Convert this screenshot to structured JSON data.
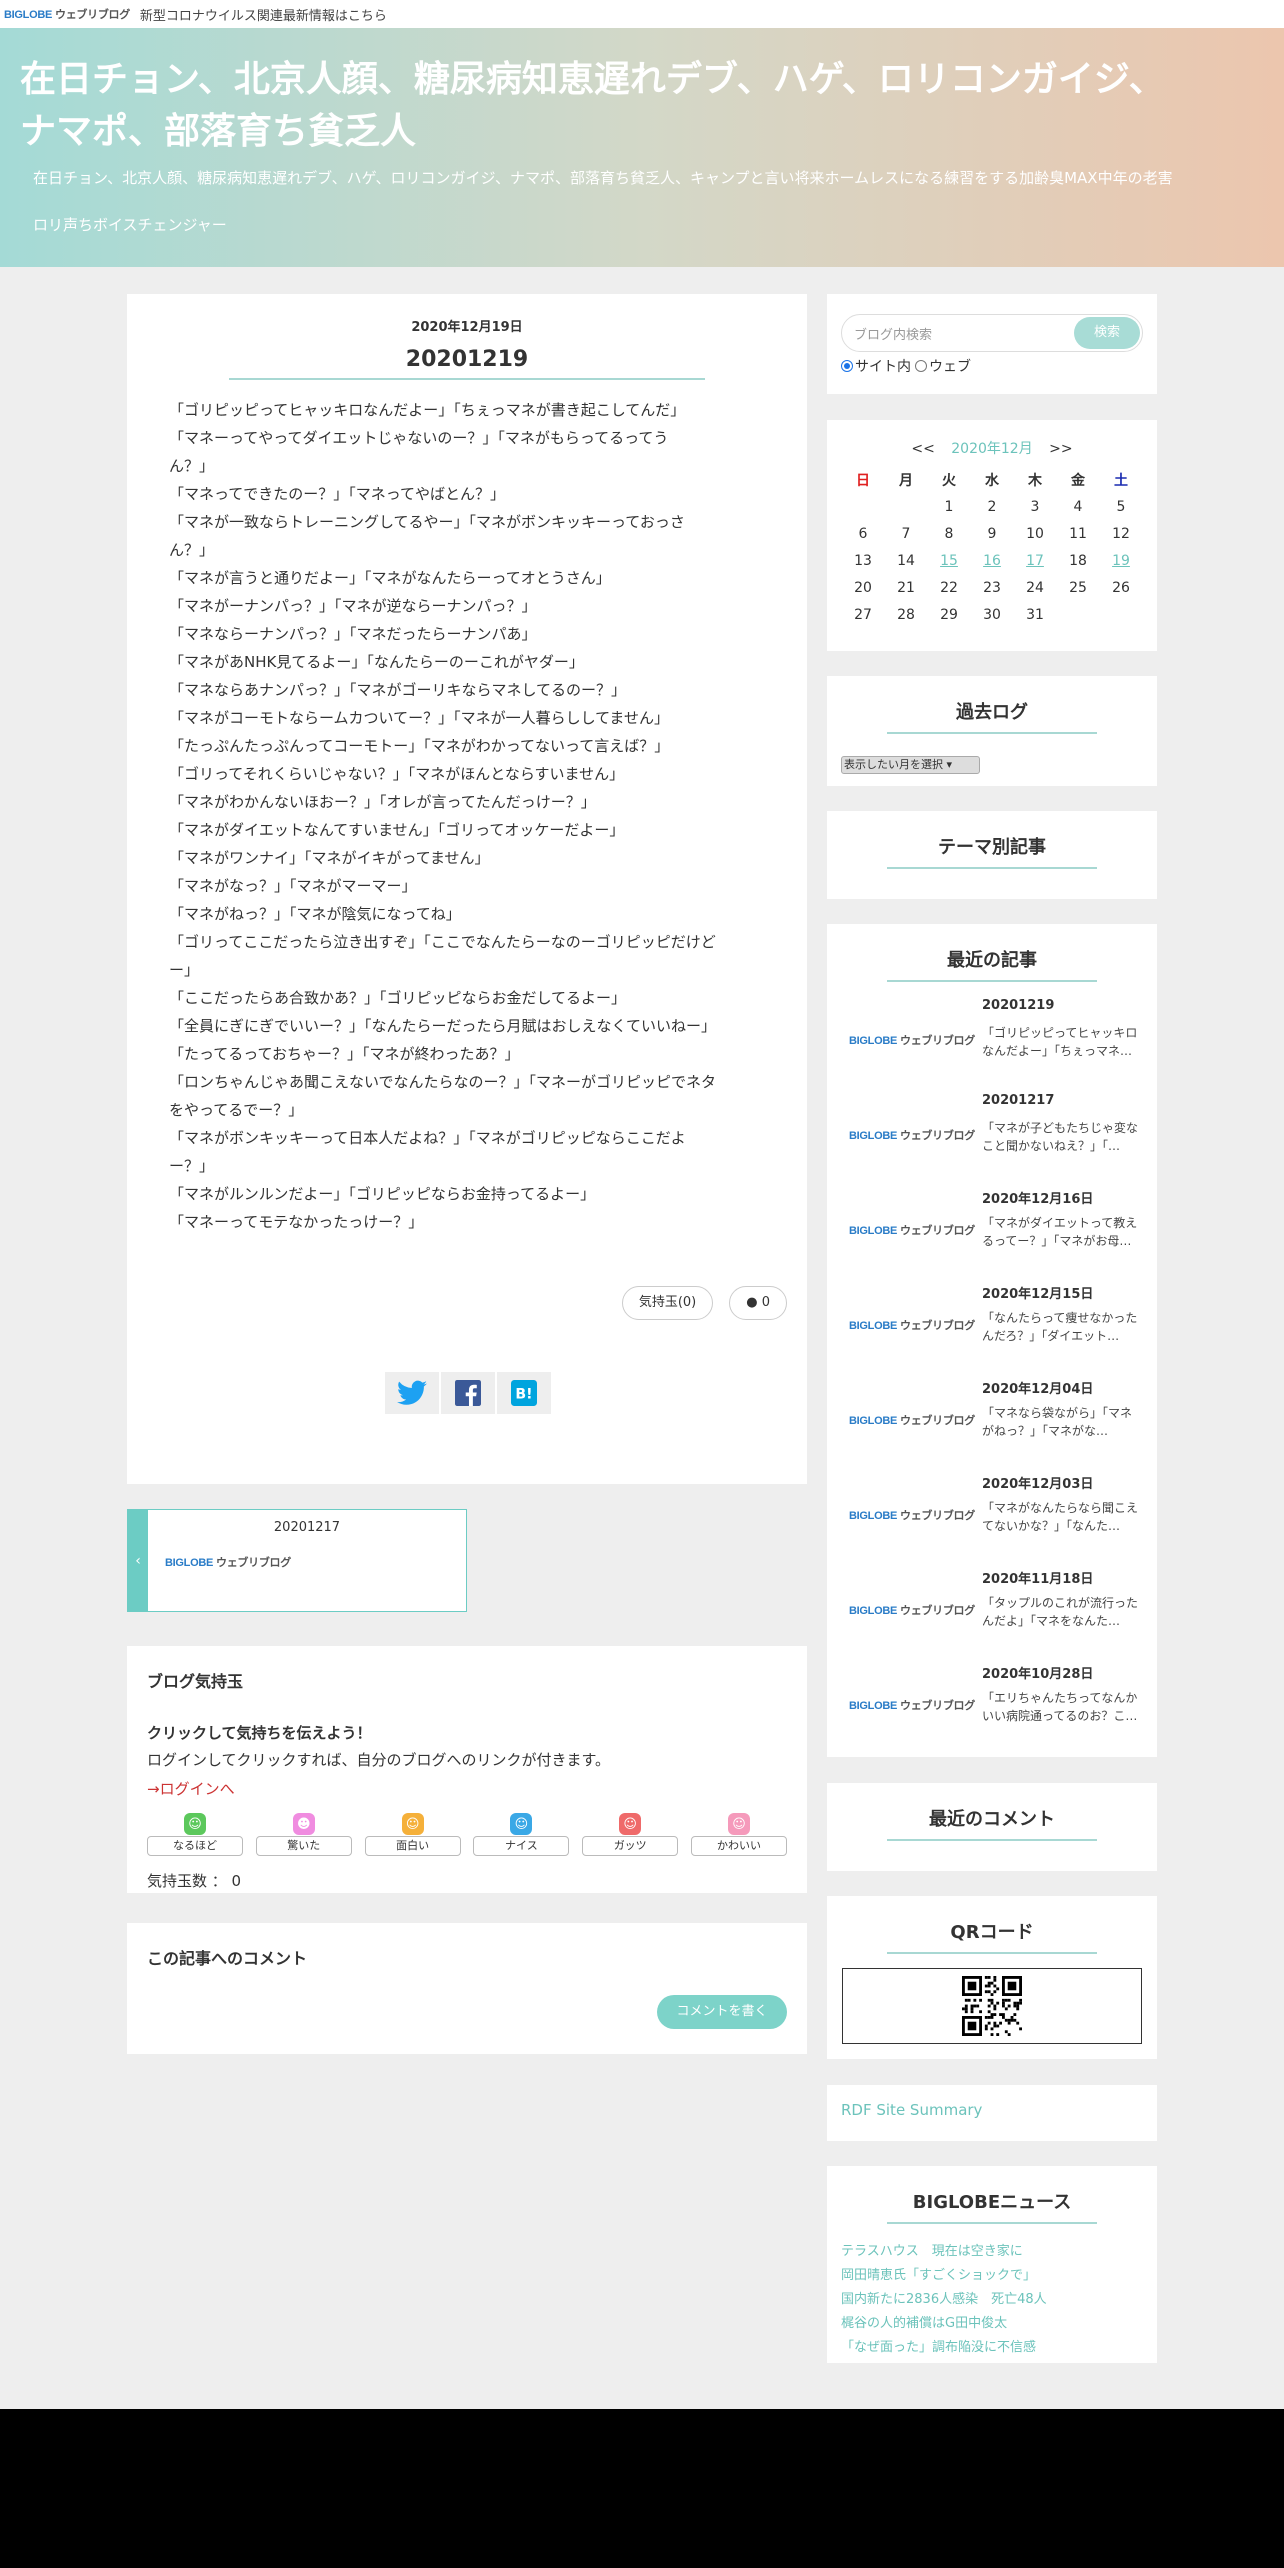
{
  "topbar": {
    "logo": "BIGLOBE",
    "logo_sub": "ウェブリブログ",
    "notice": "新型コロナウイルス関連最新情報はこちら"
  },
  "header": {
    "title_line1": "在日チョン、北京人顔、糖尿病知恵遅れデブ、ハゲ、ロリコンガイジ、",
    "title_line2": "ナマポ、部落育ち貧乏人",
    "description": "在日チョン、北京人顔、糖尿病知恵遅れデブ、ハゲ、ロリコンガイジ、ナマポ、部落育ち貧乏人、キャンプと言い将来ホームレスになる練習をする加齢臭MAX中年の老害",
    "subtitle": "ロリ声ちボイスチェンジャー"
  },
  "article": {
    "date": "2020年12月19日",
    "title": "20201219",
    "lines": [
      "「ゴリピッピってヒャッキロなんだよー」「ちぇっマネが書き起こしてんだ」",
      "「マネーってやってダイエットじゃないのー？」「マネがもらってるってう",
      "ん？」",
      "「マネってできたのー？」「マネってやばとん？」",
      "「マネが一致ならトレーニングしてるやー」「マネがボンキッキーっておっさ",
      "ん？」",
      "「マネが言うと通りだよー」「マネがなんたらーってオとうさん」",
      "「マネがーナンパっ？」「マネが逆ならーナンパっ？」",
      "「マネならーナンパっ？」「マネだったらーナンパあ」",
      "「マネがあNHK見てるよー」「なんたらーのーこれがヤダー」",
      "「マネならあナンパっ？」「マネがゴーリキならマネしてるのー？」",
      "「マネがコーモトならームカついてー？」「マネが一人暮らししてません」",
      "「たっぷんたっぷんってコーモトー」「マネがわかってないって言えば？」",
      "「ゴリってそれくらいじゃない？」「マネがほんとならすいません」",
      "「マネがわかんないほおー？」「オレが言ってたんだっけー？」",
      "「マネがダイエットなんてすいません」「ゴリってオッケーだよー」",
      "「マネがワンナイ」「マネがイキがってません」",
      "「マネがなっ？」「マネがマーマー」",
      "「マネがねっ？」「マネが陰気になってね」",
      "「ゴリってここだったら泣き出すぞ」「ここでなんたらーなのーゴリピッピだけど",
      "ー」",
      "「ここだったらあ合致かあ？」「ゴリピッピならお金だしてるよー」",
      "「全員にぎにぎでいいー？」「なんたらーだったら月賦はおしえなくていいねー」",
      "「たってるっておちゃー？」「マネが終わったあ？」",
      "「ロンちゃんじゃあ聞こえないでなんたらなのー？」「マネーがゴリピッピでネタ",
      "をやってるでー？」",
      "「マネがボンキッキーって日本人だよね？」「マネがゴリピッピならここだよ",
      "ー？」",
      "「マネがルンルンだよー」「ゴリピッピならお金持ってるよー」",
      "「マネーってモテなかったっけー？」"
    ],
    "kimochi_pill": "気持玉(0)",
    "comment_count": "0"
  },
  "prev_nav": {
    "arrow": "‹",
    "title": "20201217"
  },
  "kimochi": {
    "heading": "ブログ気持玉",
    "lead": "クリックして気持ちを伝えよう！",
    "desc": "ログインしてクリックすれば、自分のブログへのリンクが付きます。",
    "login": "→ログインへ",
    "buttons": [
      "なるほど",
      "驚いた",
      "面白い",
      "ナイス",
      "ガッツ",
      "かわいい"
    ],
    "icons": [
      "☺",
      "☻",
      "☺",
      "☺",
      "☺",
      "☺"
    ],
    "icon_colors": [
      "#5cc85c",
      "#f08ce0",
      "#f5b03a",
      "#3aa8e6",
      "#ef6a6a",
      "#f59abb"
    ],
    "count_label": "気持玉数 ： 0"
  },
  "comments": {
    "heading": "この記事へのコメント",
    "write_button": "コメントを書く"
  },
  "search": {
    "placeholder": "ブログ内検索",
    "button": "検索",
    "opt_site": "サイト内",
    "opt_web": "ウェブ"
  },
  "calendar": {
    "prev": "<<",
    "month": "2020年12月",
    "next": ">>",
    "weekdays": [
      "日",
      "月",
      "火",
      "水",
      "木",
      "金",
      "土"
    ],
    "weeks": [
      [
        "",
        "",
        "1",
        "2",
        "3",
        "4",
        "5"
      ],
      [
        "6",
        "7",
        "8",
        "9",
        "10",
        "11",
        "12"
      ],
      [
        "13",
        "14",
        "15",
        "16",
        "17",
        "18",
        "19"
      ],
      [
        "20",
        "21",
        "22",
        "23",
        "24",
        "25",
        "26"
      ],
      [
        "27",
        "28",
        "29",
        "30",
        "31",
        "",
        ""
      ]
    ],
    "linked_days": [
      "15",
      "16",
      "17",
      "19"
    ]
  },
  "archive": {
    "heading": "過去ログ",
    "select": "表示したい月を選択"
  },
  "theme": {
    "heading": "テーマ別記事"
  },
  "recent": {
    "heading": "最近の記事",
    "items": [
      {
        "title": "20201219",
        "excerpt": "「ゴリピッピってヒャッキロなんだよー」「ちぇっマネ…"
      },
      {
        "title": "20201217",
        "excerpt": "「マネが子どもたちじゃ変なこと聞かないねえ？」「…"
      },
      {
        "title": "2020年12月16日",
        "excerpt": "「マネがダイエットって教えるってー？」「マネがお母…"
      },
      {
        "title": "2020年12月15日",
        "excerpt": "「なんたらって痩せなかったんだろ？」「ダイエット…"
      },
      {
        "title": "2020年12月04日",
        "excerpt": "「マネなら袋ながら」「マネがねっ？」「マネがな…"
      },
      {
        "title": "2020年12月03日",
        "excerpt": "「マネがなんたらなら聞こえてないかな？」「なんた…"
      },
      {
        "title": "2020年11月18日",
        "excerpt": "「タップルのこれが流行ったんだよ」「マネをなんた…"
      },
      {
        "title": "2020年10月28日",
        "excerpt": "「エリちゃんたちってなんかいい病院通ってるのお？こ…"
      }
    ]
  },
  "recent_comments": {
    "heading": "最近のコメント"
  },
  "qr": {
    "heading": "QRコード"
  },
  "rdf": {
    "link": "RDF Site Summary"
  },
  "news": {
    "heading": "BIGLOBEニュース",
    "items": [
      "テラスハウス　現在は空き家に",
      "岡田晴恵氏「すごくショックで」",
      "国内新たに2836人感染　死亡48人",
      "梶谷の人的補償はG田中俊太",
      "「なぜ面った」調布陥没に不信感"
    ]
  },
  "colors": {
    "accent": "#6cccc4",
    "header_left": "#a4dad6",
    "header_right": "#ecc6ae",
    "link": "#6cc3bb",
    "login": "#cc3333"
  }
}
